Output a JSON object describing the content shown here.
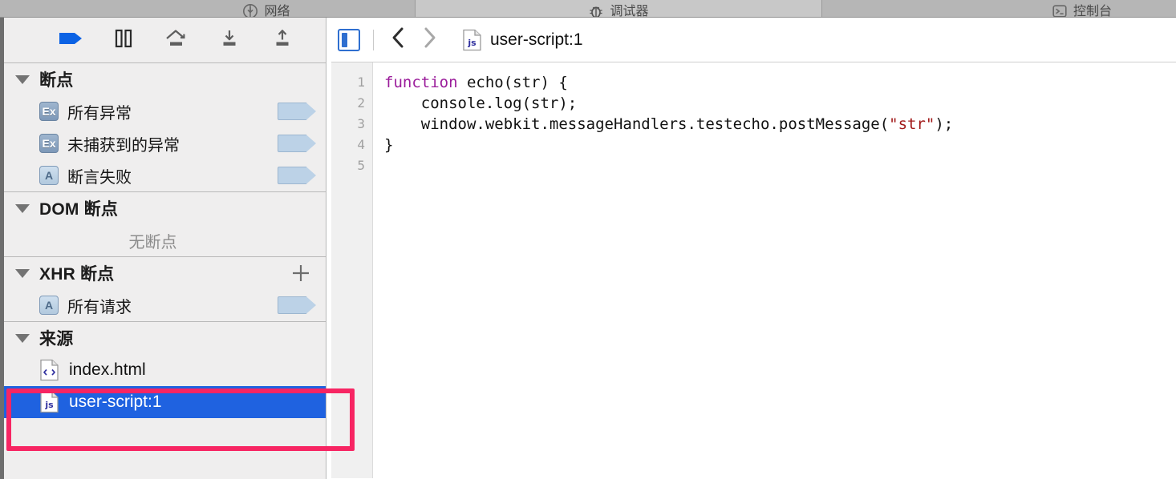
{
  "tabs": [
    {
      "label": "网络",
      "icon": "network-download-icon",
      "selected": false
    },
    {
      "label": "调试器",
      "icon": "debugger-bug-icon",
      "selected": true
    },
    {
      "label": "控制台",
      "icon": "console-prompt-icon",
      "selected": false
    }
  ],
  "debugger_toolbar": {
    "buttons": [
      {
        "name": "resume-button",
        "icon": "resume-pennant-icon",
        "active": true
      },
      {
        "name": "pause-button",
        "icon": "pause-icon",
        "active": false
      },
      {
        "name": "step-over-button",
        "icon": "step-over-icon",
        "active": false
      },
      {
        "name": "step-into-button",
        "icon": "step-into-icon",
        "active": false
      },
      {
        "name": "step-out-button",
        "icon": "step-out-icon",
        "active": false
      }
    ]
  },
  "sidebar": {
    "sections": [
      {
        "title": "断点",
        "rows": [
          {
            "badge": "Ex",
            "badge_style": "dark",
            "label": "所有异常",
            "pennant": true
          },
          {
            "badge": "Ex",
            "badge_style": "dark",
            "label": "未捕获到的异常",
            "pennant": true
          },
          {
            "badge": "A",
            "badge_style": "light",
            "label": "断言失败",
            "pennant": true
          }
        ]
      },
      {
        "title": "DOM 断点",
        "empty_text": "无断点",
        "rows": []
      },
      {
        "title": "XHR 断点",
        "add_button": "+",
        "rows": [
          {
            "badge": "A",
            "badge_style": "light",
            "label": "所有请求",
            "pennant": true
          }
        ]
      },
      {
        "title": "来源",
        "files": [
          {
            "name": "index.html",
            "icon": "html-file-icon",
            "selected": false
          },
          {
            "name": "user-script:1",
            "icon": "js-file-icon",
            "selected": true
          }
        ]
      }
    ]
  },
  "content": {
    "panel_toggle": "sidebar-toggle-icon",
    "back": "chevron-left-icon",
    "forward": "chevron-right-icon",
    "breadcrumb": {
      "icon": "js-file-icon",
      "label": "user-script:1"
    },
    "editor": {
      "line_numbers": [
        "1",
        "2",
        "3",
        "4",
        "5"
      ],
      "code_lines": [
        {
          "segments": [
            {
              "t": "function",
              "c": "kw"
            },
            {
              "t": " echo(str) {",
              "c": ""
            }
          ]
        },
        {
          "segments": [
            {
              "t": "    console.log(str);",
              "c": ""
            }
          ]
        },
        {
          "segments": [
            {
              "t": "    window.webkit.messageHandlers.testecho.postMessage(",
              "c": ""
            },
            {
              "t": "\"str\"",
              "c": "str"
            },
            {
              "t": ");",
              "c": ""
            }
          ]
        },
        {
          "segments": [
            {
              "t": "}",
              "c": ""
            }
          ]
        },
        {
          "segments": [
            {
              "t": "",
              "c": ""
            }
          ]
        }
      ]
    }
  },
  "annotation": {
    "shape": "rectangle-highlight",
    "color": "#f72563"
  },
  "colors": {
    "selection_blue": "#1f62e0",
    "annotation_pink": "#f72563",
    "sidebar_bg": "#efeeee",
    "tabbar_bg": "#b6b6b6",
    "keyword_purple": "#9b1d9b",
    "string_red": "#a21a1a"
  }
}
